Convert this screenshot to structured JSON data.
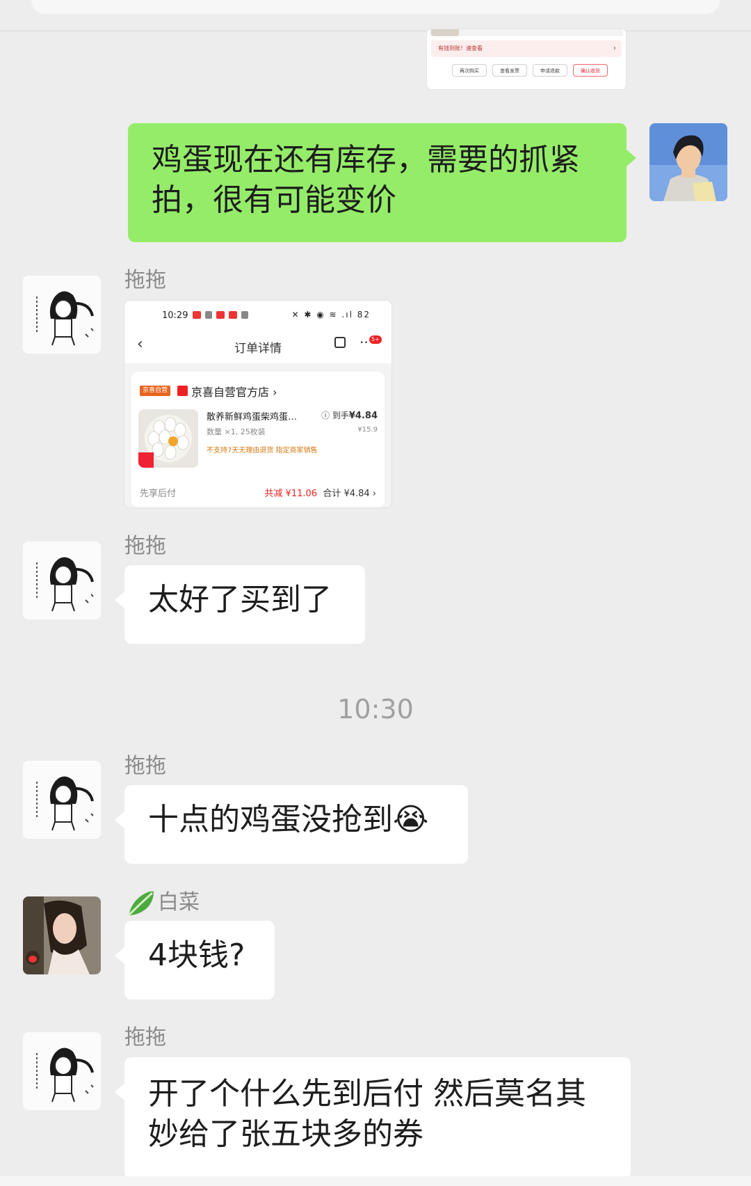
{
  "previous_image": {
    "notice": "有钱到账！速查看",
    "buttons": [
      "再次购买",
      "查看发票",
      "申请退款",
      "确认收货"
    ]
  },
  "messages": [
    {
      "side": "right",
      "type": "text",
      "text": "鸡蛋现在还有库存，需要的抓紧拍，很有可能变价"
    },
    {
      "side": "left",
      "sender": "拖拖",
      "type": "image",
      "image": {
        "status_time": "10:29",
        "status_right": "✕ ✱ ◉ ≋ .ıl 82",
        "nav_title": "订单详情",
        "badge": "5+",
        "store_tag": "京喜自营",
        "store_name": "京喜自营官方店 ›",
        "product_name": "散养新鲜鸡蛋柴鸡蛋…",
        "received_price_label": "ⓘ 到手",
        "received_price": "¥4.84",
        "quantity": "数量 ×1, 25枚装",
        "original_price": "¥15.9",
        "policy": "不支持7天无理由退货   指定商家销售",
        "pay_method": "先享后付",
        "discount": "共减 ¥11.06",
        "total": "合计 ¥4.84 ›"
      }
    },
    {
      "side": "left",
      "sender": "拖拖",
      "type": "text",
      "text": "太好了买到了"
    },
    {
      "type": "time",
      "text": "10:30"
    },
    {
      "side": "left",
      "sender": "拖拖",
      "type": "text",
      "text": "十点的鸡蛋没抢到😭"
    },
    {
      "side": "left",
      "sender": "白菜",
      "sender_icon": "cabbage-emoji",
      "type": "text",
      "text": "4块钱?"
    },
    {
      "side": "left",
      "sender": "拖拖",
      "type": "text",
      "text": "开了个什么先到后付 然后莫名其妙给了张五块多的券"
    }
  ],
  "colors": {
    "background": "#ededed",
    "my_bubble": "#95ec69",
    "their_bubble": "#ffffff",
    "name": "#8a8a8a"
  }
}
